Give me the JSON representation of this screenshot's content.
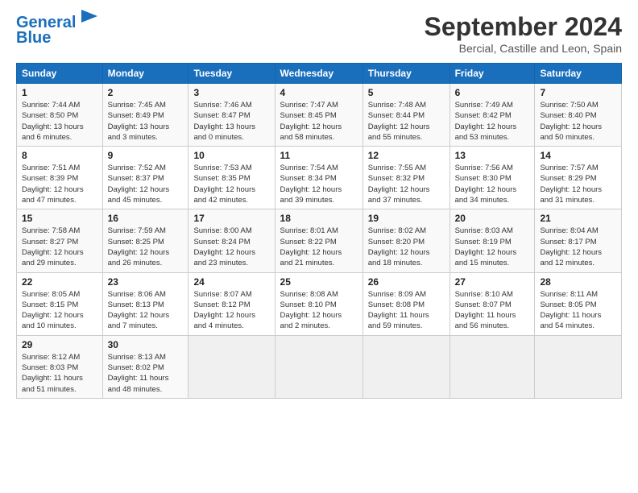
{
  "header": {
    "logo_line1": "General",
    "logo_line2": "Blue",
    "title": "September 2024",
    "subtitle": "Bercial, Castille and Leon, Spain"
  },
  "days_of_week": [
    "Sunday",
    "Monday",
    "Tuesday",
    "Wednesday",
    "Thursday",
    "Friday",
    "Saturday"
  ],
  "weeks": [
    [
      {
        "day": "1",
        "info": "Sunrise: 7:44 AM\nSunset: 8:50 PM\nDaylight: 13 hours\nand 6 minutes."
      },
      {
        "day": "2",
        "info": "Sunrise: 7:45 AM\nSunset: 8:49 PM\nDaylight: 13 hours\nand 3 minutes."
      },
      {
        "day": "3",
        "info": "Sunrise: 7:46 AM\nSunset: 8:47 PM\nDaylight: 13 hours\nand 0 minutes."
      },
      {
        "day": "4",
        "info": "Sunrise: 7:47 AM\nSunset: 8:45 PM\nDaylight: 12 hours\nand 58 minutes."
      },
      {
        "day": "5",
        "info": "Sunrise: 7:48 AM\nSunset: 8:44 PM\nDaylight: 12 hours\nand 55 minutes."
      },
      {
        "day": "6",
        "info": "Sunrise: 7:49 AM\nSunset: 8:42 PM\nDaylight: 12 hours\nand 53 minutes."
      },
      {
        "day": "7",
        "info": "Sunrise: 7:50 AM\nSunset: 8:40 PM\nDaylight: 12 hours\nand 50 minutes."
      }
    ],
    [
      {
        "day": "8",
        "info": "Sunrise: 7:51 AM\nSunset: 8:39 PM\nDaylight: 12 hours\nand 47 minutes."
      },
      {
        "day": "9",
        "info": "Sunrise: 7:52 AM\nSunset: 8:37 PM\nDaylight: 12 hours\nand 45 minutes."
      },
      {
        "day": "10",
        "info": "Sunrise: 7:53 AM\nSunset: 8:35 PM\nDaylight: 12 hours\nand 42 minutes."
      },
      {
        "day": "11",
        "info": "Sunrise: 7:54 AM\nSunset: 8:34 PM\nDaylight: 12 hours\nand 39 minutes."
      },
      {
        "day": "12",
        "info": "Sunrise: 7:55 AM\nSunset: 8:32 PM\nDaylight: 12 hours\nand 37 minutes."
      },
      {
        "day": "13",
        "info": "Sunrise: 7:56 AM\nSunset: 8:30 PM\nDaylight: 12 hours\nand 34 minutes."
      },
      {
        "day": "14",
        "info": "Sunrise: 7:57 AM\nSunset: 8:29 PM\nDaylight: 12 hours\nand 31 minutes."
      }
    ],
    [
      {
        "day": "15",
        "info": "Sunrise: 7:58 AM\nSunset: 8:27 PM\nDaylight: 12 hours\nand 29 minutes."
      },
      {
        "day": "16",
        "info": "Sunrise: 7:59 AM\nSunset: 8:25 PM\nDaylight: 12 hours\nand 26 minutes."
      },
      {
        "day": "17",
        "info": "Sunrise: 8:00 AM\nSunset: 8:24 PM\nDaylight: 12 hours\nand 23 minutes."
      },
      {
        "day": "18",
        "info": "Sunrise: 8:01 AM\nSunset: 8:22 PM\nDaylight: 12 hours\nand 21 minutes."
      },
      {
        "day": "19",
        "info": "Sunrise: 8:02 AM\nSunset: 8:20 PM\nDaylight: 12 hours\nand 18 minutes."
      },
      {
        "day": "20",
        "info": "Sunrise: 8:03 AM\nSunset: 8:19 PM\nDaylight: 12 hours\nand 15 minutes."
      },
      {
        "day": "21",
        "info": "Sunrise: 8:04 AM\nSunset: 8:17 PM\nDaylight: 12 hours\nand 12 minutes."
      }
    ],
    [
      {
        "day": "22",
        "info": "Sunrise: 8:05 AM\nSunset: 8:15 PM\nDaylight: 12 hours\nand 10 minutes."
      },
      {
        "day": "23",
        "info": "Sunrise: 8:06 AM\nSunset: 8:13 PM\nDaylight: 12 hours\nand 7 minutes."
      },
      {
        "day": "24",
        "info": "Sunrise: 8:07 AM\nSunset: 8:12 PM\nDaylight: 12 hours\nand 4 minutes."
      },
      {
        "day": "25",
        "info": "Sunrise: 8:08 AM\nSunset: 8:10 PM\nDaylight: 12 hours\nand 2 minutes."
      },
      {
        "day": "26",
        "info": "Sunrise: 8:09 AM\nSunset: 8:08 PM\nDaylight: 11 hours\nand 59 minutes."
      },
      {
        "day": "27",
        "info": "Sunrise: 8:10 AM\nSunset: 8:07 PM\nDaylight: 11 hours\nand 56 minutes."
      },
      {
        "day": "28",
        "info": "Sunrise: 8:11 AM\nSunset: 8:05 PM\nDaylight: 11 hours\nand 54 minutes."
      }
    ],
    [
      {
        "day": "29",
        "info": "Sunrise: 8:12 AM\nSunset: 8:03 PM\nDaylight: 11 hours\nand 51 minutes."
      },
      {
        "day": "30",
        "info": "Sunrise: 8:13 AM\nSunset: 8:02 PM\nDaylight: 11 hours\nand 48 minutes."
      },
      {
        "day": "",
        "info": ""
      },
      {
        "day": "",
        "info": ""
      },
      {
        "day": "",
        "info": ""
      },
      {
        "day": "",
        "info": ""
      },
      {
        "day": "",
        "info": ""
      }
    ]
  ]
}
